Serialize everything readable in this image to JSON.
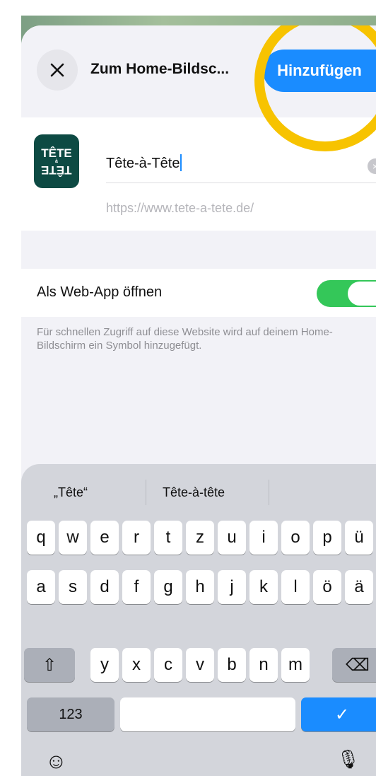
{
  "header": {
    "title": "Zum Home-Bildsc...",
    "add_label": "Hinzufügen"
  },
  "shortcut": {
    "icon_top": "TÊTE",
    "icon_mid": "à",
    "icon_bottom": "TÊTE",
    "name_value": "Tête-à-Tête",
    "url": "https://www.tete-a-tete.de/"
  },
  "webapp": {
    "label": "Als Web-App öffnen",
    "toggle_on": true,
    "footnote": "Für schnellen Zugriff auf diese Website wird auf deinem Home-Bildschirm ein Symbol hinzugefügt."
  },
  "keyboard": {
    "suggestions": [
      "„Tête“",
      "Tête-à-tête"
    ],
    "rows": [
      [
        "q",
        "w",
        "e",
        "r",
        "t",
        "z",
        "u",
        "i",
        "o",
        "p",
        "ü"
      ],
      [
        "a",
        "s",
        "d",
        "f",
        "g",
        "h",
        "j",
        "k",
        "l",
        "ö",
        "ä"
      ],
      [
        "y",
        "x",
        "c",
        "v",
        "b",
        "n",
        "m"
      ]
    ],
    "numbers_label": "123",
    "return_symbol": "✓",
    "shift_symbol": "⇧",
    "delete_symbol": "⌫",
    "emoji_symbol": "☺",
    "mic_symbol": "🎙"
  },
  "colors": {
    "accent": "#1a8cff",
    "toggle_on": "#34c759",
    "highlight": "#f7c300",
    "icon_bg": "#0d4a43"
  }
}
